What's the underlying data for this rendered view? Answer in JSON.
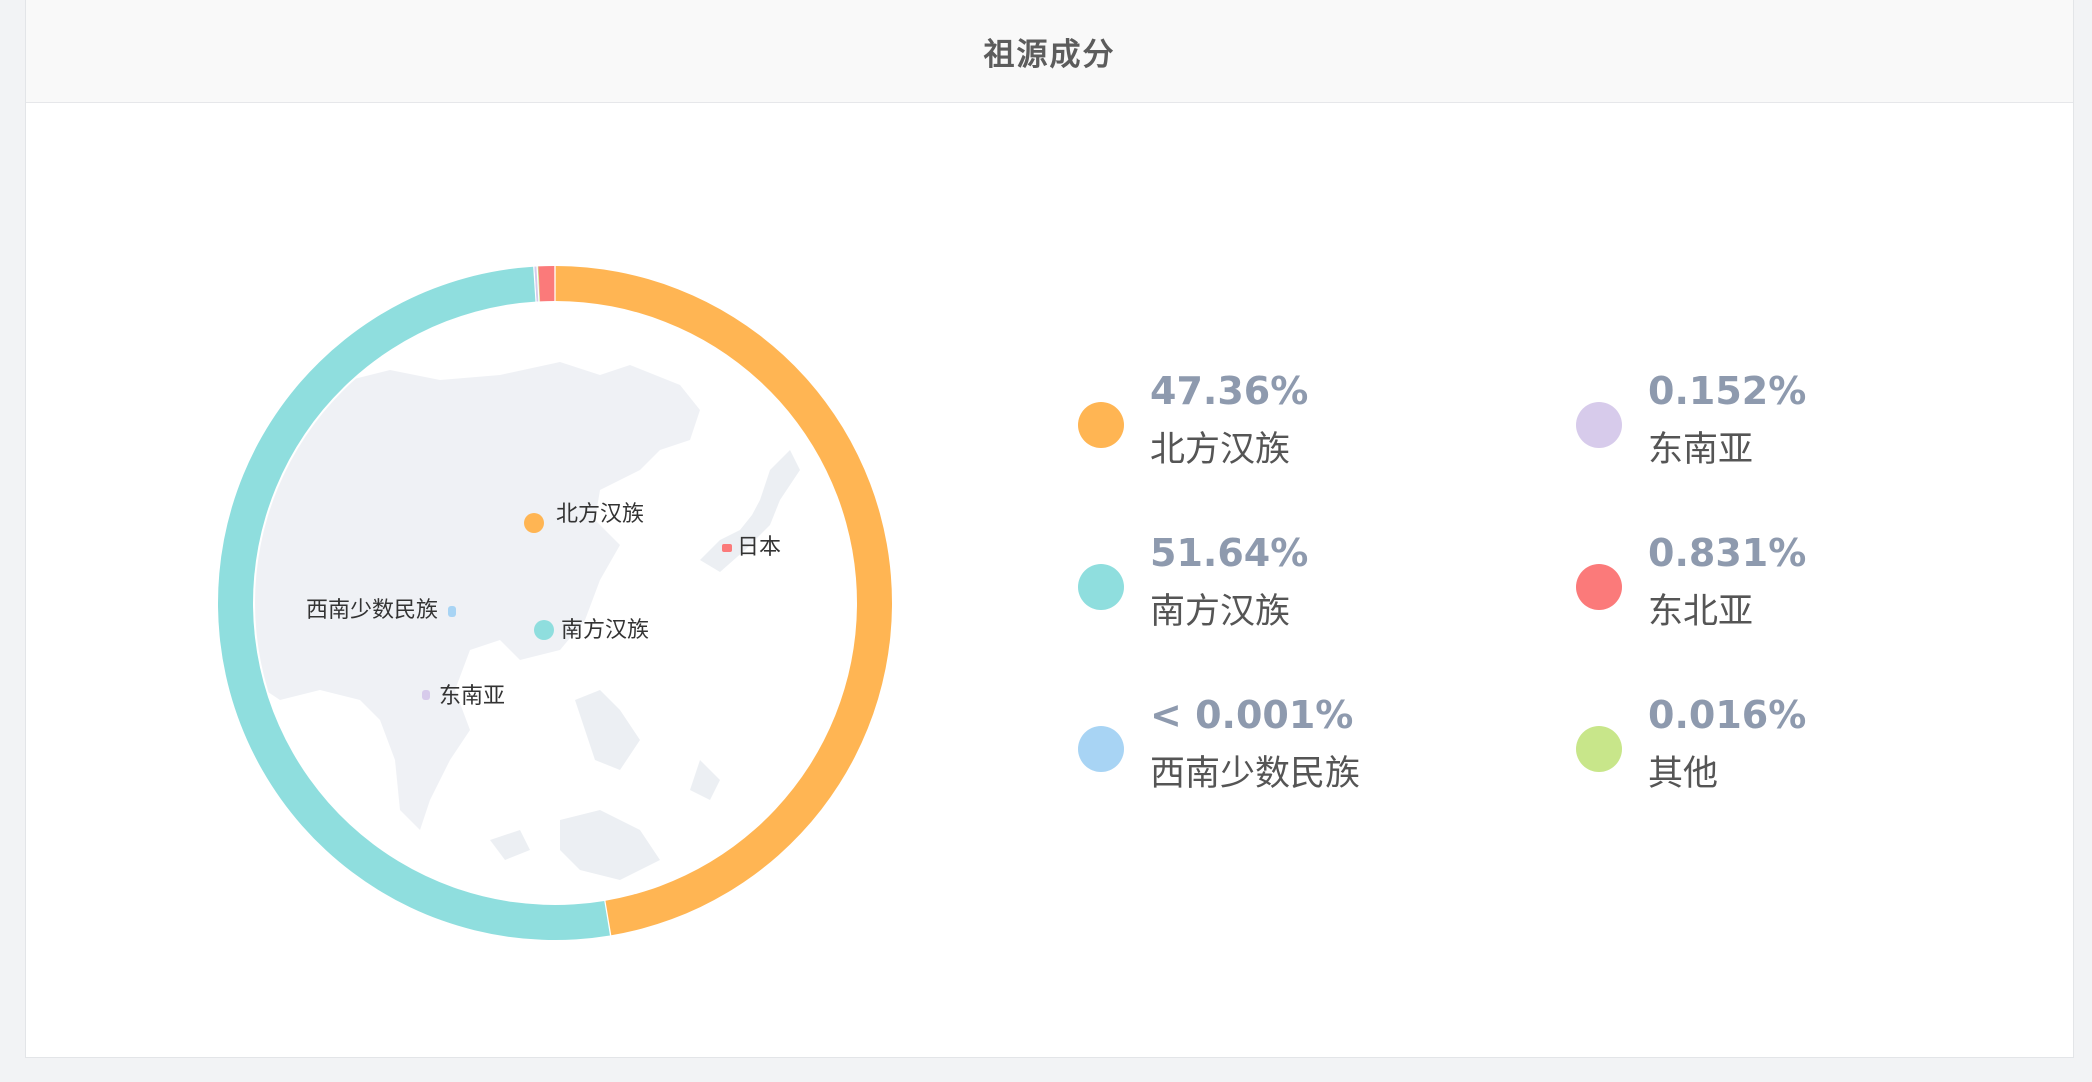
{
  "header": {
    "title": "祖源成分"
  },
  "colors": {
    "north_han": "#ffb553",
    "south_han": "#8fdede",
    "southwest_minority": "#a8d4f4",
    "southeast_asia": "#d7cbeb",
    "northeast_asia": "#fb7a7a",
    "other": "#c8e68a"
  },
  "chart_data": {
    "type": "pie",
    "subtype": "donut",
    "background": "asia-map",
    "slices": [
      {
        "name": "北方汉族",
        "value": 47.36,
        "label": "47.36%",
        "color": "#ffb553"
      },
      {
        "name": "南方汉族",
        "value": 51.64,
        "label": "51.64%",
        "color": "#8fdede"
      },
      {
        "name": "西南少数民族",
        "value": 0.001,
        "label": "< 0.001%",
        "color": "#a8d4f4"
      },
      {
        "name": "东南亚",
        "value": 0.152,
        "label": "0.152%",
        "color": "#d7cbeb"
      },
      {
        "name": "东北亚",
        "value": 0.831,
        "label": "0.831%",
        "color": "#fb7a7a"
      },
      {
        "name": "其他",
        "value": 0.016,
        "label": "0.016%",
        "color": "#c8e68a"
      }
    ],
    "map_markers": [
      {
        "label": "北方汉族",
        "color": "#ffb553",
        "size": "large"
      },
      {
        "label": "日本",
        "color": "#fb7a7a",
        "size": "small"
      },
      {
        "label": "西南少数民族",
        "color": "#a8d4f4",
        "size": "small"
      },
      {
        "label": "南方汉族",
        "color": "#8fdede",
        "size": "large"
      },
      {
        "label": "东南亚",
        "color": "#d7cbeb",
        "size": "small"
      }
    ]
  },
  "legend": [
    {
      "pct": "47.36%",
      "name": "北方汉族",
      "color": "#ffb553"
    },
    {
      "pct": "0.152%",
      "name": "东南亚",
      "color": "#d7cbeb"
    },
    {
      "pct": "51.64%",
      "name": "南方汉族",
      "color": "#8fdede"
    },
    {
      "pct": "0.831%",
      "name": "东北亚",
      "color": "#fb7a7a"
    },
    {
      "pct": "< 0.001%",
      "name": "西南少数民族",
      "color": "#a8d4f4"
    },
    {
      "pct": "0.016%",
      "name": "其他",
      "color": "#c8e68a"
    }
  ]
}
